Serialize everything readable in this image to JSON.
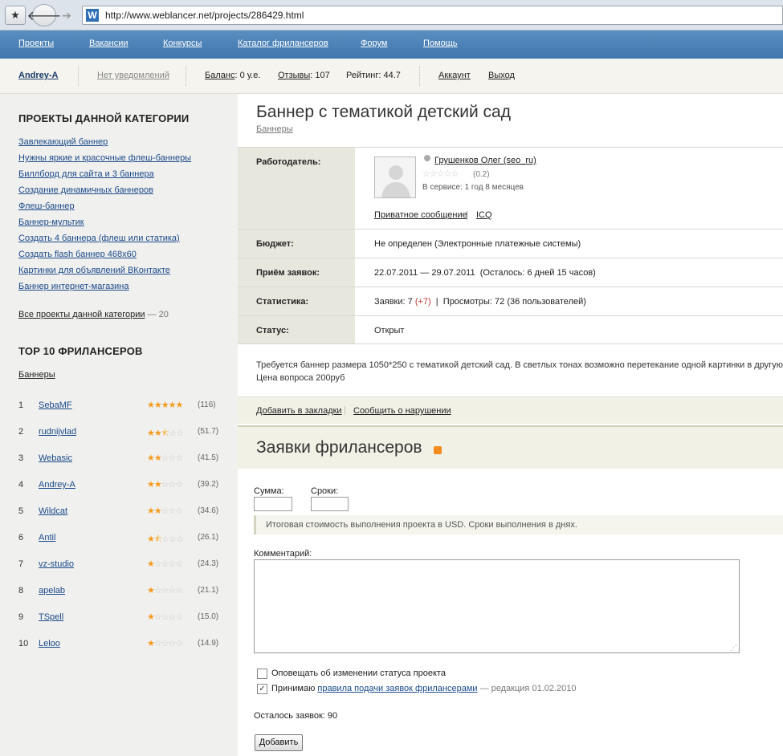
{
  "browser": {
    "url": "http://www.weblancer.net/projects/286429.html",
    "site_icon": "W"
  },
  "nav": [
    "Проекты",
    "Вакансии",
    "Конкурсы",
    "Каталог фрилансеров",
    "Форум",
    "Помощь"
  ],
  "userbar": {
    "username": "Andrey-A",
    "notifications": "Нет уведомлений",
    "balance_label": "Баланс",
    "balance_value": ": 0 у.е.",
    "reviews_label": "Отзывы",
    "reviews_value": ": 107",
    "rating": "Рейтинг: 44.7",
    "account": "Аккаунт",
    "logout": "Выход"
  },
  "sidebar": {
    "category_heading": "ПРОЕКТЫ ДАННОЙ КАТЕГОРИИ",
    "projects": [
      "Завлекающий баннер",
      "Нужны яркие и красочные флеш-баннеры",
      "Биллборд для сайта и 3 баннера",
      "Создание динамичных баннеров",
      "Флеш-баннер",
      "Баннер-мультик",
      "Создать 4 баннера (флеш или статика)",
      "Создать flash баннер 468x60",
      "Картинки для объявлений ВКонтакте",
      "Баннер интернет-магазина"
    ],
    "all_projects": "Все проекты данной категории",
    "all_count": "— 20",
    "top_heading": "TOP 10 ФРИЛАНСЕРОВ",
    "top_category": "Баннеры",
    "freelancers": [
      {
        "rank": "1",
        "name": "SebaMF",
        "stars": 5,
        "score": "(116)"
      },
      {
        "rank": "2",
        "name": "rudnijvlad",
        "stars": 2.5,
        "score": "(51.7)"
      },
      {
        "rank": "3",
        "name": "Webasic",
        "stars": 2,
        "score": "(41.5)"
      },
      {
        "rank": "4",
        "name": "Andrey-A",
        "stars": 2,
        "score": "(39.2)"
      },
      {
        "rank": "5",
        "name": "Wildcat",
        "stars": 2,
        "score": "(34.6)"
      },
      {
        "rank": "6",
        "name": "Antil",
        "stars": 1.5,
        "score": "(26.1)"
      },
      {
        "rank": "7",
        "name": "vz-studio",
        "stars": 1,
        "score": "(24.3)"
      },
      {
        "rank": "8",
        "name": "apelab",
        "stars": 1,
        "score": "(21.1)"
      },
      {
        "rank": "9",
        "name": "TSpell",
        "stars": 1,
        "score": "(15.0)"
      },
      {
        "rank": "10",
        "name": "Leloo",
        "stars": 1,
        "score": "(14.9)"
      }
    ]
  },
  "project": {
    "title": "Баннер с тематикой детский сад",
    "category": "Баннеры",
    "employer_label": "Работодатель:",
    "employer_name": "Грушенков Олег (seo_ru)",
    "employer_rating": "(0.2)",
    "employer_since": "В сервисе: 1 год 8 месяцев",
    "private_message": "Приватное сообщение",
    "icq": "ICQ",
    "budget_label": "Бюджет:",
    "budget_value": "Не определен (Электронные платежные системы)",
    "dates_label": "Приём заявок:",
    "dates_value": "22.07.2011 — 29.07.2011  (Осталось: 6 дней 15 часов)",
    "stats_label": "Статистика:",
    "stats_bids": "Заявки: 7",
    "stats_new": "(+7)",
    "stats_views": "Просмотры: 72 (36 пользователей)",
    "status_label": "Статус:",
    "status_value": "Открыт",
    "description_line1": "Требуется баннер размера 1050*250 с тематикой детский сад. В светлых тонах возможно перетекание одной картинки в другую, м",
    "description_line2": "Цена вопроса 200руб",
    "bookmark": "Добавить в закладки",
    "report": "Сообщить о нарушении"
  },
  "bids": {
    "heading": "Заявки фрилансеров",
    "sum_label": "Сумма:",
    "term_label": "Сроки:",
    "hint": "Итоговая стоимость выполнения проекта в USD. Сроки выполнения в днях.",
    "comment_label": "Комментарий:",
    "notify_label": "Оповещать об изменении статуса проекта",
    "notify_checked": false,
    "accept_prefix": "Принимаю",
    "accept_link": "правила подачи заявок фрилансерами",
    "accept_suffix": "— редакция 01.02.2010",
    "accept_checked": true,
    "remaining": "Осталось заявок: 90",
    "submit": "Добавить"
  }
}
